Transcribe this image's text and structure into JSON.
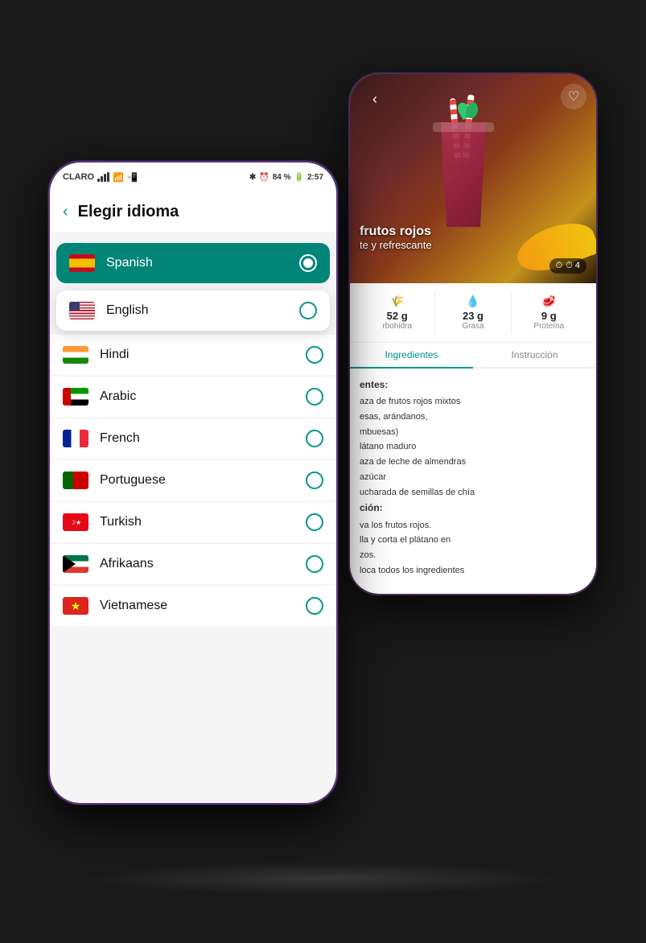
{
  "scene": {
    "background": "#1a1a1a"
  },
  "backPhone": {
    "recipeImageTitle1": "frutos rojos",
    "recipeImageTitle2": "te y refrescante",
    "clockBadge": "⏱ 4",
    "nutritionItems": [
      {
        "icon": "🌾",
        "value": "52 g",
        "label": "rbohidra"
      },
      {
        "icon": "💧",
        "value": "23 g",
        "label": "Grasa"
      },
      {
        "icon": "🥩",
        "value": "9 g",
        "label": "Proteína"
      }
    ],
    "tabs": [
      "Ingredientes",
      "Instrucción"
    ],
    "activeTab": 0,
    "ingredients": [
      "entes:",
      "aza de frutos rojos mixtos",
      "esas, arándanos,",
      "mbuesas)",
      "látano maduro",
      "aza de leche de almendras",
      "azúcar",
      "ucharada de semillas de chía",
      "ción:",
      "va los frutos rojos.",
      "lla y corta el plátano en",
      "zos.",
      "loca todos los ingredientes"
    ]
  },
  "frontPhone": {
    "statusBar": {
      "carrier": "CLARO",
      "bluetooth": "✱",
      "alarm": "⏰",
      "battery": "84 %",
      "time": "2:57"
    },
    "header": {
      "backLabel": "‹",
      "title": "Elegir idioma"
    },
    "languages": [
      {
        "name": "Spanish",
        "selected": true,
        "flagType": "spain"
      },
      {
        "name": "English",
        "selected": false,
        "flagType": "us"
      },
      {
        "name": "Hindi",
        "selected": false,
        "flagType": "hindi"
      },
      {
        "name": "Arabic",
        "selected": false,
        "flagType": "uae"
      },
      {
        "name": "French",
        "selected": false,
        "flagType": "france"
      },
      {
        "name": "Portuguese",
        "selected": false,
        "flagType": "portugal"
      },
      {
        "name": "Turkish",
        "selected": false,
        "flagType": "turkey"
      },
      {
        "name": "Afrikaans",
        "selected": false,
        "flagType": "sa"
      },
      {
        "name": "Vietnamese",
        "selected": false,
        "flagType": "vietnam"
      }
    ]
  }
}
